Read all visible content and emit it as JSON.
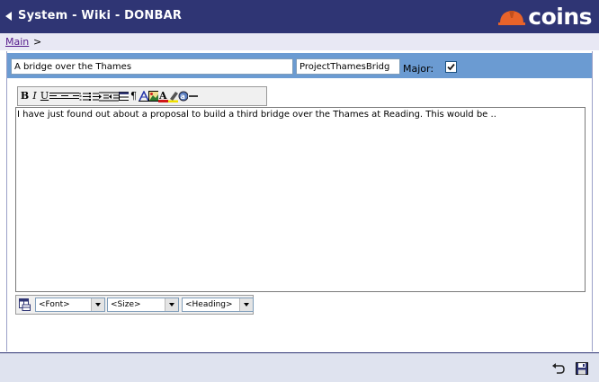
{
  "header": {
    "title": "System - Wiki - DONBAR",
    "logo_text": "coins",
    "logo_color": "#e8632a"
  },
  "breadcrumb": {
    "link": "Main",
    "separator": ">"
  },
  "form": {
    "title_value": "A bridge over the Thames",
    "page_name_value": "ProjectThamesBridg",
    "major_label": "Major:",
    "major_checked": true
  },
  "toolbar": {
    "bold": "B",
    "italic": "I",
    "underline": "U",
    "paragraph": "¶",
    "font_color_letter": "A",
    "icons": [
      "bold-icon",
      "italic-icon",
      "underline-icon",
      "align-left-icon",
      "align-center-icon",
      "align-right-icon",
      "numbered-list-icon",
      "bullet-list-icon",
      "indent-icon",
      "outdent-icon",
      "horizontal-table-icon",
      "paragraph-icon",
      "insert-link-icon",
      "insert-image-icon",
      "font-color-icon",
      "highlight-icon",
      "spellcheck-icon",
      "horizontal-rule-icon"
    ]
  },
  "editor": {
    "content": "I have just found out about a proposal to build a third bridge over the Thames at Reading.  This would be .."
  },
  "format_bar": {
    "font": "<Font>",
    "size": "<Size>",
    "heading": "<Heading>"
  },
  "footer": {
    "icons": [
      "undo-icon",
      "save-icon"
    ]
  },
  "colors": {
    "header_bg": "#2f3574",
    "band_bg": "#6b9bd2",
    "link": "#551a8b"
  }
}
